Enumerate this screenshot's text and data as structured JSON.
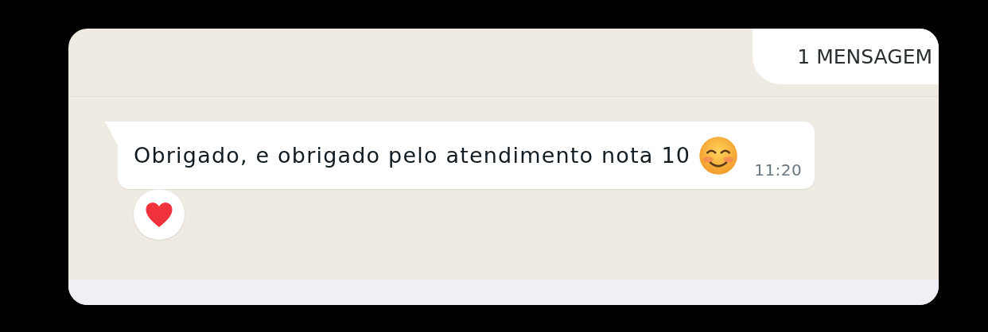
{
  "unread_banner": {
    "text": "1 MENSAGEM"
  },
  "messages": [
    {
      "text": "Obrigado, e obrigado pelo atendimento nota 10",
      "time": "11:20",
      "reacted": true
    }
  ]
}
